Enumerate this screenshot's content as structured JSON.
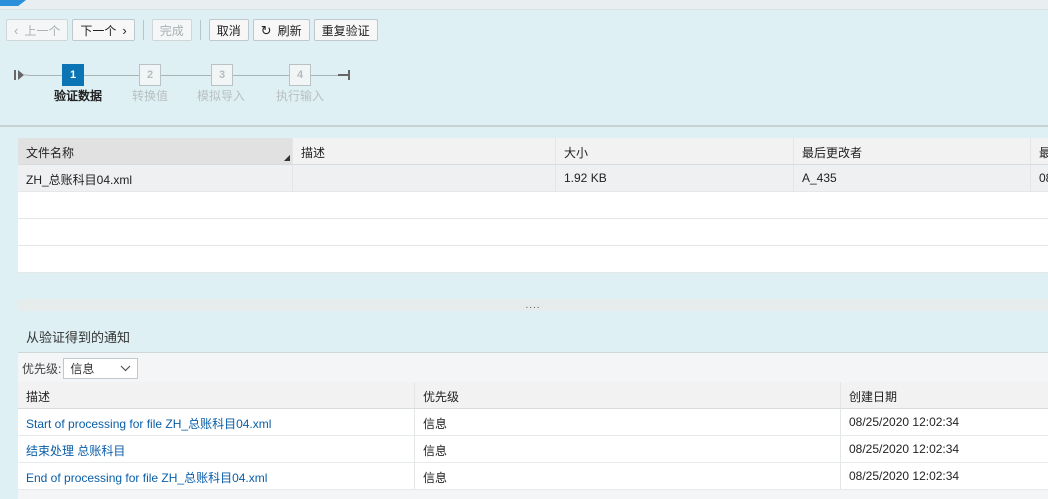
{
  "toolbar": {
    "prev_label": "上一个",
    "next_label": "下一个",
    "finish_label": "完成",
    "cancel_label": "取消",
    "refresh_label": "刷新",
    "revalidate_label": "重复验证"
  },
  "roadmap": {
    "steps": [
      {
        "number": "1",
        "label": "验证数据"
      },
      {
        "number": "2",
        "label": "转换值"
      },
      {
        "number": "3",
        "label": "模拟导入"
      },
      {
        "number": "4",
        "label": "执行输入"
      }
    ]
  },
  "files": {
    "columns": [
      "文件名称",
      "描述",
      "大小",
      "最后更改者",
      "最"
    ],
    "rows": [
      {
        "name": "ZH_总账科目04.xml",
        "description": "",
        "size": "1.92 KB",
        "changed_by": "A_435",
        "last": "08"
      }
    ]
  },
  "splitter_glyph": "....",
  "notifications": {
    "title": "从验证得到的通知",
    "priority_label": "优先级:",
    "priority_value": "信息",
    "columns": [
      "描述",
      "优先级",
      "创建日期"
    ],
    "rows": [
      {
        "description": "Start of processing for file ZH_总账科目04.xml",
        "priority": "信息",
        "created": "08/25/2020 12:02:34"
      },
      {
        "description": "结束处理 总账科目",
        "priority": "信息",
        "created": "08/25/2020 12:02:34"
      },
      {
        "description": "End of processing for file ZH_总账科目04.xml",
        "priority": "信息",
        "created": "08/25/2020 12:02:34"
      }
    ]
  },
  "icons": {
    "prev": "chevron-left-icon",
    "next": "chevron-right-icon",
    "refresh": "refresh-icon",
    "dropdown": "chevron-down-icon"
  },
  "colors": {
    "accent": "#0b74b5",
    "link": "#0a5ea8",
    "background": "#dff0f4"
  }
}
